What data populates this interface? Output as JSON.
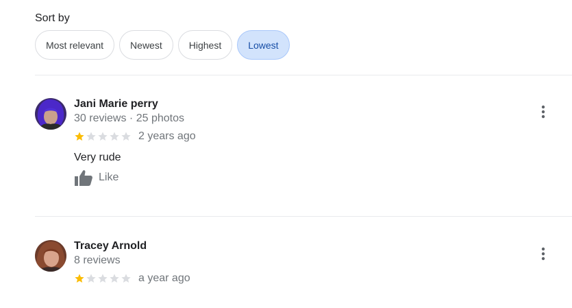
{
  "sort": {
    "label": "Sort by",
    "options": [
      "Most relevant",
      "Newest",
      "Highest",
      "Lowest"
    ],
    "selected": "Lowest"
  },
  "reviews": [
    {
      "name": "Jani Marie perry",
      "meta": "30 reviews · 25 photos",
      "rating": 1,
      "max_rating": 5,
      "time": "2 years ago",
      "text": "Very rude",
      "like_label": "Like"
    },
    {
      "name": "Tracey Arnold",
      "meta": "8 reviews",
      "rating": 1,
      "max_rating": 5,
      "time": "a year ago"
    }
  ],
  "colors": {
    "star_filled": "#fbbc04",
    "star_empty": "#dadce0",
    "chip_active_bg": "#d2e3fc",
    "chip_active_text": "#174ea6"
  }
}
